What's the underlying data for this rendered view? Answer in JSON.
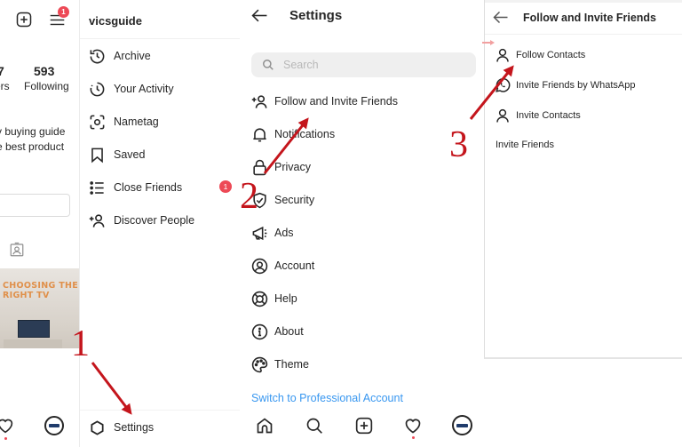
{
  "profile_panel": {
    "menu_badge": "1",
    "stats": [
      {
        "value": "7",
        "label": "ers"
      },
      {
        "value": "593",
        "label": "Following"
      }
    ],
    "bio_lines": [
      "y buying guide",
      "e best product"
    ],
    "post": {
      "headline": "CHOOSING THE RIGHT TV"
    }
  },
  "drawer": {
    "username": "vicsguide",
    "items": [
      {
        "label": "Archive",
        "icon": "archive-icon"
      },
      {
        "label": "Your Activity",
        "icon": "activity-icon"
      },
      {
        "label": "Nametag",
        "icon": "nametag-icon"
      },
      {
        "label": "Saved",
        "icon": "bookmark-icon"
      },
      {
        "label": "Close Friends",
        "icon": "list-icon",
        "badge": "1"
      },
      {
        "label": "Discover People",
        "icon": "add-person-icon"
      }
    ],
    "settings_label": "Settings"
  },
  "settings": {
    "title": "Settings",
    "search_placeholder": "Search",
    "search_value": "",
    "items": [
      {
        "label": "Follow and Invite Friends",
        "icon": "add-person-icon"
      },
      {
        "label": "Notifications",
        "icon": "bell-icon"
      },
      {
        "label": "Privacy",
        "icon": "lock-icon"
      },
      {
        "label": "Security",
        "icon": "shield-check-icon"
      },
      {
        "label": "Ads",
        "icon": "megaphone-icon"
      },
      {
        "label": "Account",
        "icon": "account-icon"
      },
      {
        "label": "Help",
        "icon": "lifebuoy-icon"
      },
      {
        "label": "About",
        "icon": "info-icon"
      },
      {
        "label": "Theme",
        "icon": "palette-icon"
      }
    ],
    "professional_link": "Switch to Professional Account",
    "nav": [
      "home-icon",
      "search-icon",
      "new-post-icon",
      "activity-heart-icon",
      "profile-avatar"
    ]
  },
  "follow_invite": {
    "title": "Follow and Invite Friends",
    "items": [
      {
        "label": "Follow Contacts",
        "icon": "person-icon"
      },
      {
        "label": "Invite Friends by WhatsApp",
        "icon": "whatsapp-icon"
      },
      {
        "label": "Invite Contacts",
        "icon": "person-icon"
      }
    ],
    "invite_friends_label": "Invite Friends"
  },
  "annotations": {
    "step1": "1",
    "step2": "2",
    "step3": "3",
    "color": "#c4151c"
  },
  "colors": {
    "badge": "#ed4956",
    "link": "#3897f0",
    "text": "#262626"
  }
}
